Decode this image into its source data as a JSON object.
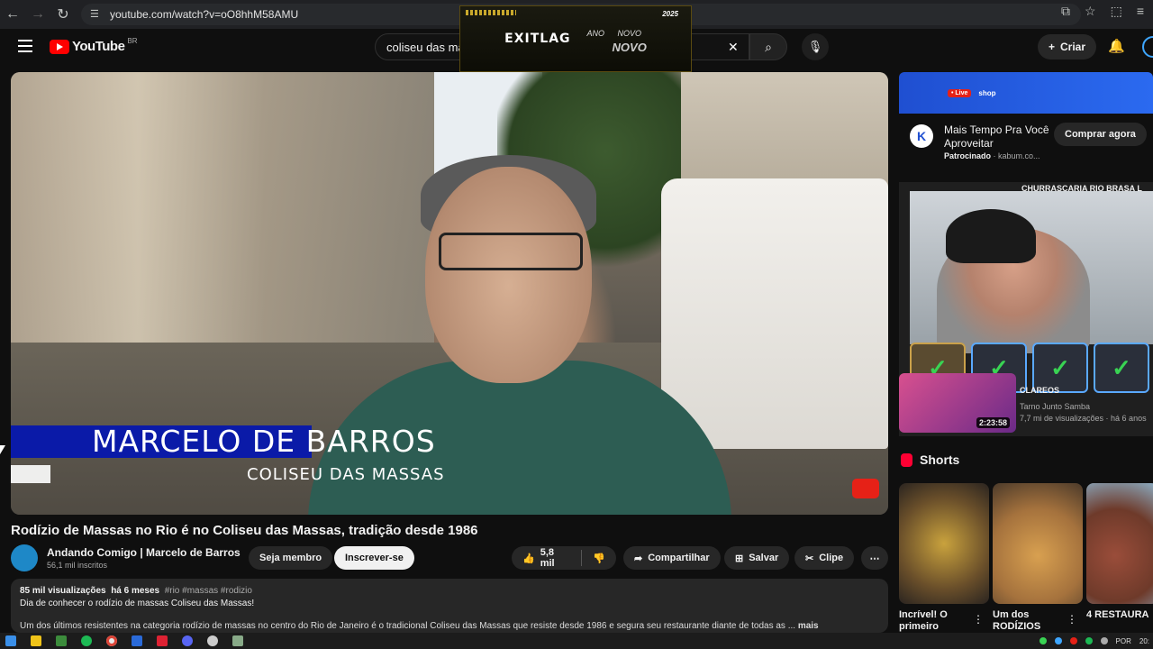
{
  "browser": {
    "url": "youtube.com/watch?v=oO8hhM58AMU"
  },
  "overlay_ad": {
    "brand": "EXITLAG",
    "ano": "ANO",
    "novo_small": "NOVO",
    "novo_big": "NOVO",
    "year": "2025"
  },
  "header": {
    "logo_text": "YouTube",
    "logo_country": "BR",
    "search_value": "coliseu das ma",
    "create_label": "Criar"
  },
  "video": {
    "lower_third_name": "MARCELO DE BARROS",
    "lower_third_sub": "COLISEU DAS MASSAS",
    "title": "Rodízio de Massas no Rio é no Coliseu das Massas, tradição desde 1986"
  },
  "channel": {
    "name": "Andando Comigo | Marcelo de Barros",
    "subscribers": "56,1 mil inscritos",
    "member_label": "Seja membro",
    "subscribe_label": "Inscrever-se"
  },
  "actions": {
    "likes": "5,8 mil",
    "share": "Compartilhar",
    "save": "Salvar",
    "clip": "Clipe"
  },
  "description": {
    "views": "85 mil visualizações",
    "age": "há 6 meses",
    "tags": "#rio #massas #rodizio",
    "line1": "Dia de conhecer o rodízio de massas Coliseu das Massas!",
    "line2": "Um dos últimos resistentes na categoria rodízio de massas no centro do Rio de Janeiro é o tradicional Coliseu das Massas que resiste desde 1986 e segura seu restaurante diante de todas as ...",
    "more": "mais"
  },
  "sidebar_ad": {
    "live": "• Live",
    "shop": "shop",
    "title": "Mais Tempo Pra Você Aproveitar",
    "sponsored": "Patrocinado",
    "domain": "kabum.co...",
    "cta": "Comprar agora"
  },
  "rec": {
    "top_title": "CHURRASCARIA RIO BRASA L",
    "second_label": "CLAREOS",
    "second_channel": "Tarno Junto Samba",
    "second_views": "7,7 mi de visualizações · há 6 anos",
    "second_duration": "2:23:58"
  },
  "shorts": {
    "heading": "Shorts",
    "items": [
      {
        "title": "Incrível! O primeiro"
      },
      {
        "title": "Um dos RODÍZIOS"
      },
      {
        "title": "4 RESTAURA"
      }
    ]
  },
  "taskbar": {
    "lang": "POR",
    "time": "20:"
  }
}
